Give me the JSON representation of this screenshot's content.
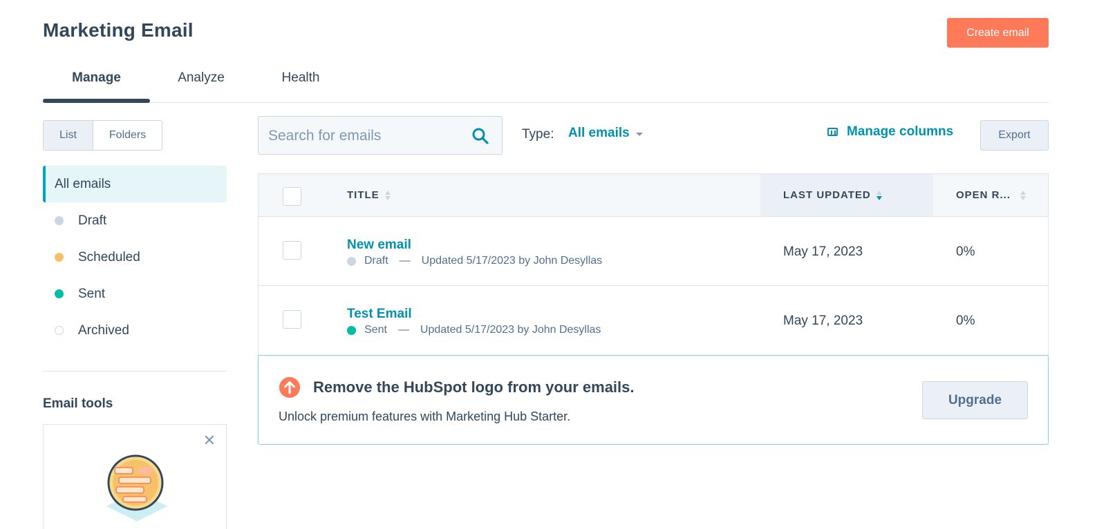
{
  "header": {
    "title": "Marketing Email",
    "create_button": "Create email"
  },
  "tabs": [
    {
      "label": "Manage",
      "active": true
    },
    {
      "label": "Analyze",
      "active": false
    },
    {
      "label": "Health",
      "active": false
    }
  ],
  "view_toggle": {
    "list": "List",
    "folders": "Folders",
    "selected": "List"
  },
  "filters": [
    {
      "label": "All emails",
      "active": true
    },
    {
      "label": "Draft",
      "status": "draft"
    },
    {
      "label": "Scheduled",
      "status": "scheduled"
    },
    {
      "label": "Sent",
      "status": "sent"
    },
    {
      "label": "Archived",
      "status": "archived"
    }
  ],
  "email_tools": {
    "heading": "Email tools",
    "close_icon": "close-icon",
    "illustration_icon": "email-illustration-icon"
  },
  "toolbar": {
    "search_placeholder": "Search for emails",
    "type_label": "Type:",
    "type_value": "All emails",
    "manage_columns": "Manage columns",
    "export": "Export"
  },
  "table": {
    "columns": [
      "TITLE",
      "LAST UPDATED",
      "OPEN R..."
    ],
    "sorted_column": "LAST UPDATED",
    "rows": [
      {
        "title": "New email",
        "status": "Draft",
        "updated_text": "Updated 5/17/2023 by John Desyllas",
        "last_updated": "May 17, 2023",
        "open_rate": "0%"
      },
      {
        "title": "Test Email",
        "status": "Sent",
        "updated_text": "Updated 5/17/2023 by John Desyllas",
        "last_updated": "May 17, 2023",
        "open_rate": "0%"
      }
    ]
  },
  "upsell": {
    "title": "Remove the HubSpot logo from your emails.",
    "subtitle": "Unlock premium features with Marketing Hub Starter.",
    "button": "Upgrade"
  },
  "separator": "—",
  "colors": {
    "accent": "#ff7a59",
    "link": "#0091ae",
    "text": "#33475b",
    "draft": "#cbd6e2",
    "scheduled": "#f5c26b",
    "sent": "#00bda5"
  }
}
